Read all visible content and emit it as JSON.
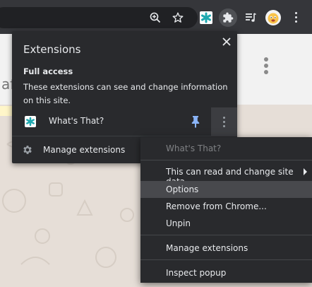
{
  "browser": {
    "toolbar_icons": [
      "zoom-icon",
      "bookmark-star-icon",
      "whats-that-extension-icon",
      "puzzle-icon",
      "media-queue-icon",
      "profile-avatar"
    ]
  },
  "background_page": {
    "title_fragment": "af"
  },
  "extensions_panel": {
    "title": "Extensions",
    "close_icon": "close-icon",
    "access_heading": "Full access",
    "access_description": "These extensions can see and change information on this site.",
    "extension": {
      "name": "What's That?",
      "pinned": true
    },
    "manage_label": "Manage extensions"
  },
  "context_menu": {
    "header": "What's That?",
    "items": [
      {
        "label": "This can read and change site data",
        "has_submenu": true
      },
      {
        "label": "Options",
        "highlighted": true
      },
      {
        "label": "Remove from Chrome..."
      },
      {
        "label": "Unpin"
      },
      {
        "label": "Manage extensions"
      },
      {
        "label": "Inspect popup"
      }
    ]
  },
  "colors": {
    "toolbar_bg": "#35363a",
    "panel_bg": "#292a2d",
    "accent_teal": "#1fa9b0",
    "pin_blue": "#8ab4f8"
  }
}
